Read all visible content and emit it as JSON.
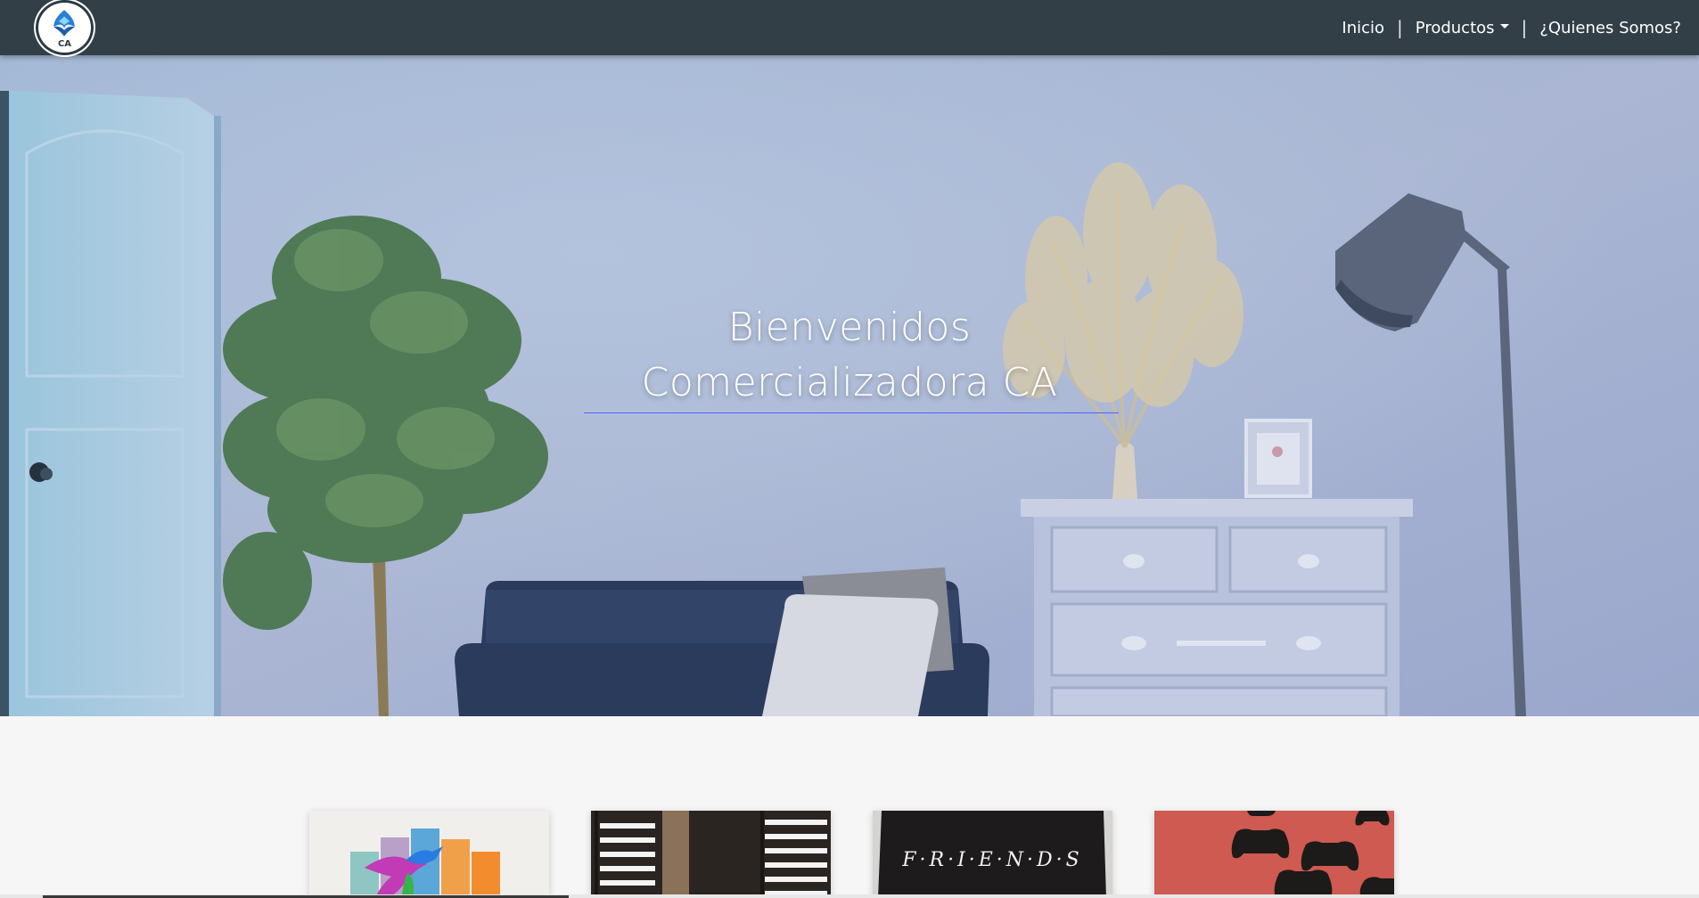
{
  "navbar": {
    "logo_text": "CA",
    "links": [
      {
        "label": "Inicio"
      },
      {
        "label": "Productos"
      },
      {
        "label": "¿Quienes Somos?"
      }
    ],
    "separator": "|"
  },
  "hero": {
    "title_line1": "Bienvenidos",
    "title_line2": "Comercializadora CA"
  },
  "products": {
    "cards": [
      {
        "name": "hummingbird-canvas"
      },
      {
        "name": "zebra-blinds"
      },
      {
        "name": "friends-pillow",
        "text": "F·R·I·E·N·D·S"
      },
      {
        "name": "gamepad-pattern"
      }
    ]
  },
  "colors": {
    "navbar": "#323f47",
    "hero_overlay": "#8ea3cf",
    "background": "#f6f6f6",
    "accent_line": "#3d53ff"
  }
}
